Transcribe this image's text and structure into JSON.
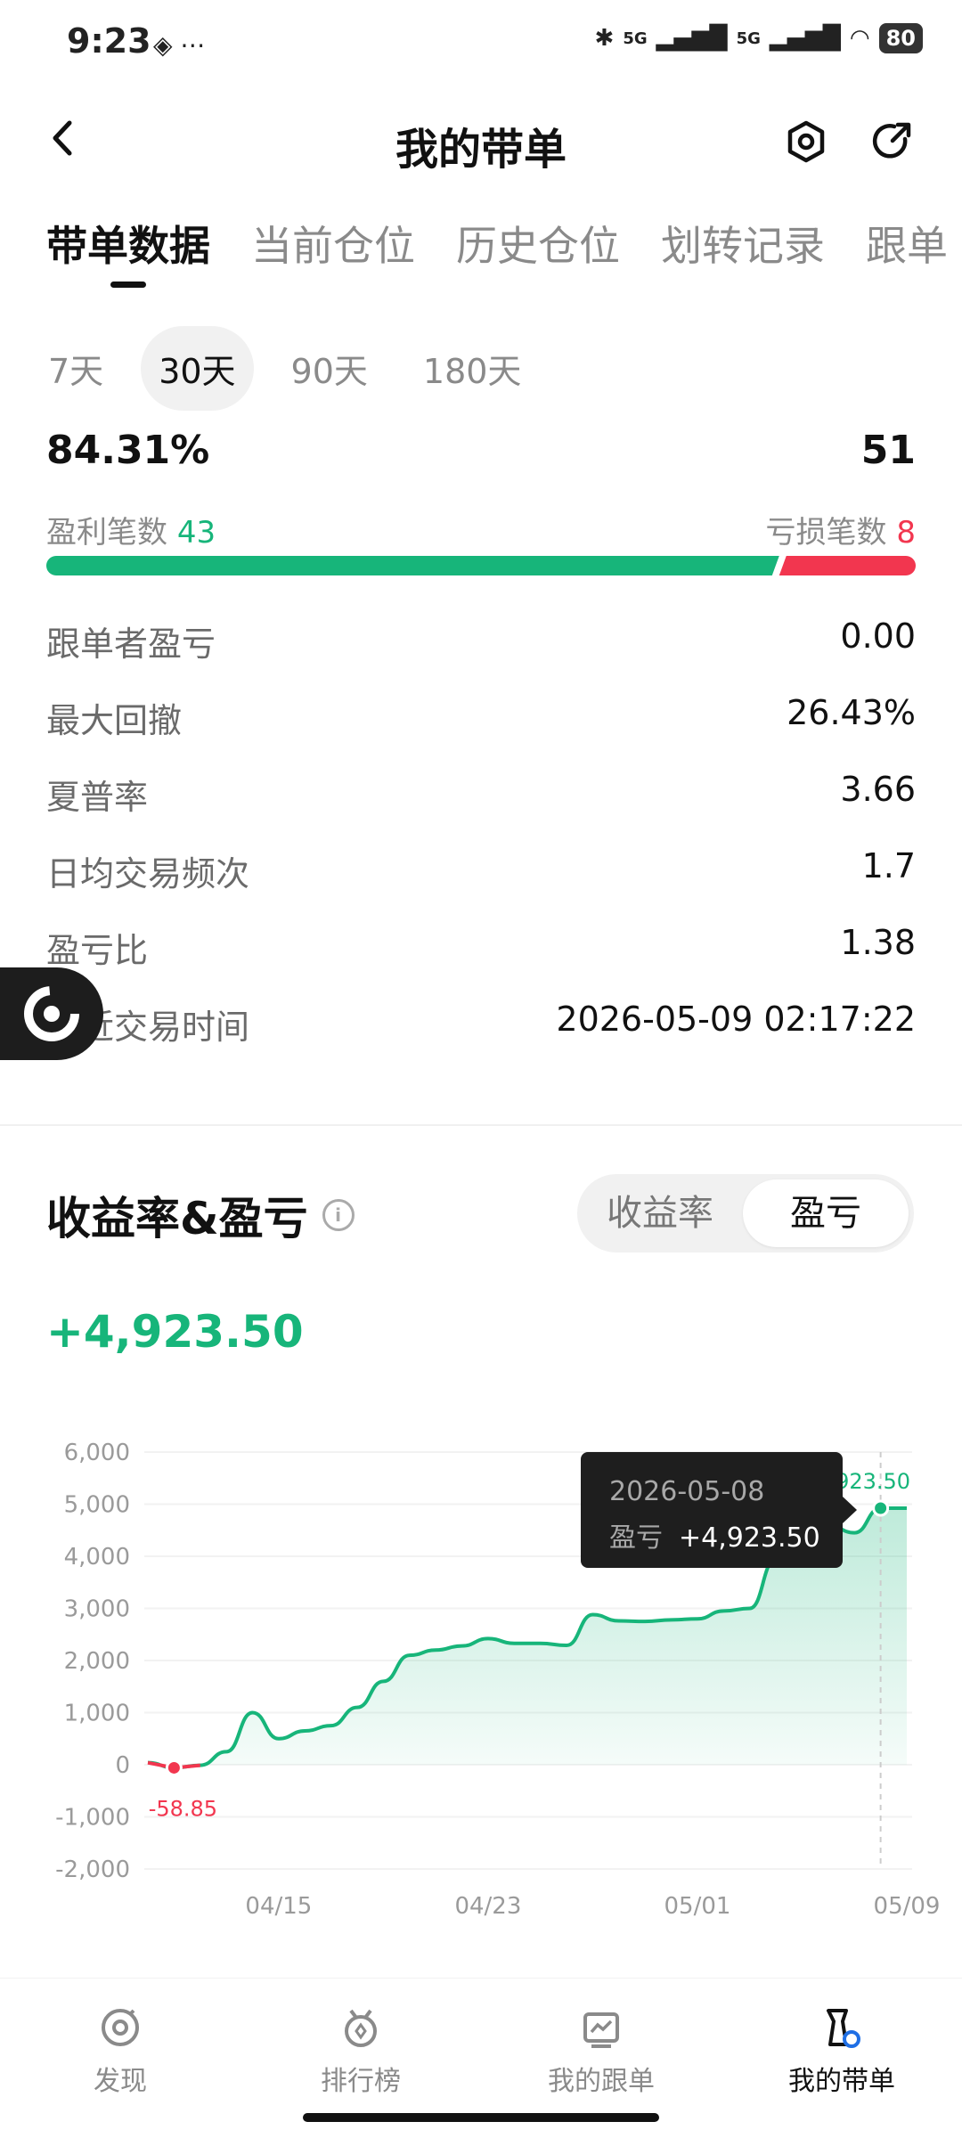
{
  "status": {
    "time": "9:23",
    "battery": "80",
    "signal1": "5G",
    "signal2": "5G"
  },
  "header": {
    "title": "我的带单"
  },
  "tabs": [
    "带单数据",
    "当前仓位",
    "历史仓位",
    "划转记录",
    "跟单"
  ],
  "periods": [
    "7天",
    "30天",
    "90天",
    "180天"
  ],
  "selected_period": "30天",
  "summary": {
    "win_rate": "84.31%",
    "total_trades": "51",
    "win_label": "盈利笔数",
    "win_count": "43",
    "loss_label": "亏损笔数",
    "loss_count": "8",
    "win_fraction": 0.843
  },
  "stats": [
    {
      "label": "跟单者盈亏",
      "value": "0.00"
    },
    {
      "label": "最大回撤",
      "value": "26.43%"
    },
    {
      "label": "夏普率",
      "value": "3.66"
    },
    {
      "label": "日均交易频次",
      "value": "1.7"
    },
    {
      "label": "盈亏比",
      "value": "1.38"
    },
    {
      "label": "最近交易时间",
      "value": "2026-05-09 02:17:22"
    }
  ],
  "section": {
    "title": "收益率&盈亏",
    "toggle": [
      "收益率",
      "盈亏"
    ],
    "toggle_selected": "盈亏",
    "pnl_value": "+4,923.50"
  },
  "tooltip": {
    "date": "2026-05-08",
    "label": "盈亏",
    "value": "+4,923.50"
  },
  "chart_data": {
    "type": "area",
    "ylim": [
      -2000,
      6000
    ],
    "yticks": [
      "6,000",
      "5,000",
      "4,000",
      "3,000",
      "2,000",
      "1,000",
      "0",
      "-1,000",
      "-2,000"
    ],
    "xticks": [
      "04/15",
      "04/23",
      "05/01",
      "05/09"
    ],
    "min_label": "-58.85",
    "max_label": "4,923.50",
    "x": [
      "04/10",
      "04/11",
      "04/12",
      "04/13",
      "04/14",
      "04/15",
      "04/16",
      "04/17",
      "04/18",
      "04/19",
      "04/20",
      "04/21",
      "04/22",
      "04/23",
      "04/24",
      "04/25",
      "04/26",
      "04/27",
      "04/28",
      "04/29",
      "04/30",
      "05/01",
      "05/02",
      "05/03",
      "05/04",
      "05/05",
      "05/06",
      "05/07",
      "05/08",
      "05/09"
    ],
    "values": [
      40,
      -58.85,
      -10,
      250,
      1000,
      500,
      650,
      750,
      1100,
      1600,
      2100,
      2200,
      2280,
      2420,
      2330,
      2330,
      2290,
      2880,
      2760,
      2750,
      2780,
      2800,
      2950,
      3000,
      3950,
      4150,
      4600,
      4450,
      4923.5,
      4923.5
    ],
    "line_color": "#17b57a",
    "negative_color": "#f2364f"
  },
  "nav": [
    {
      "label": "发现",
      "icon": "discover-icon"
    },
    {
      "label": "排行榜",
      "icon": "ranking-icon"
    },
    {
      "label": "我的跟单",
      "icon": "my-copy-icon"
    },
    {
      "label": "我的带单",
      "icon": "my-lead-icon"
    }
  ],
  "nav_selected": "我的带单"
}
